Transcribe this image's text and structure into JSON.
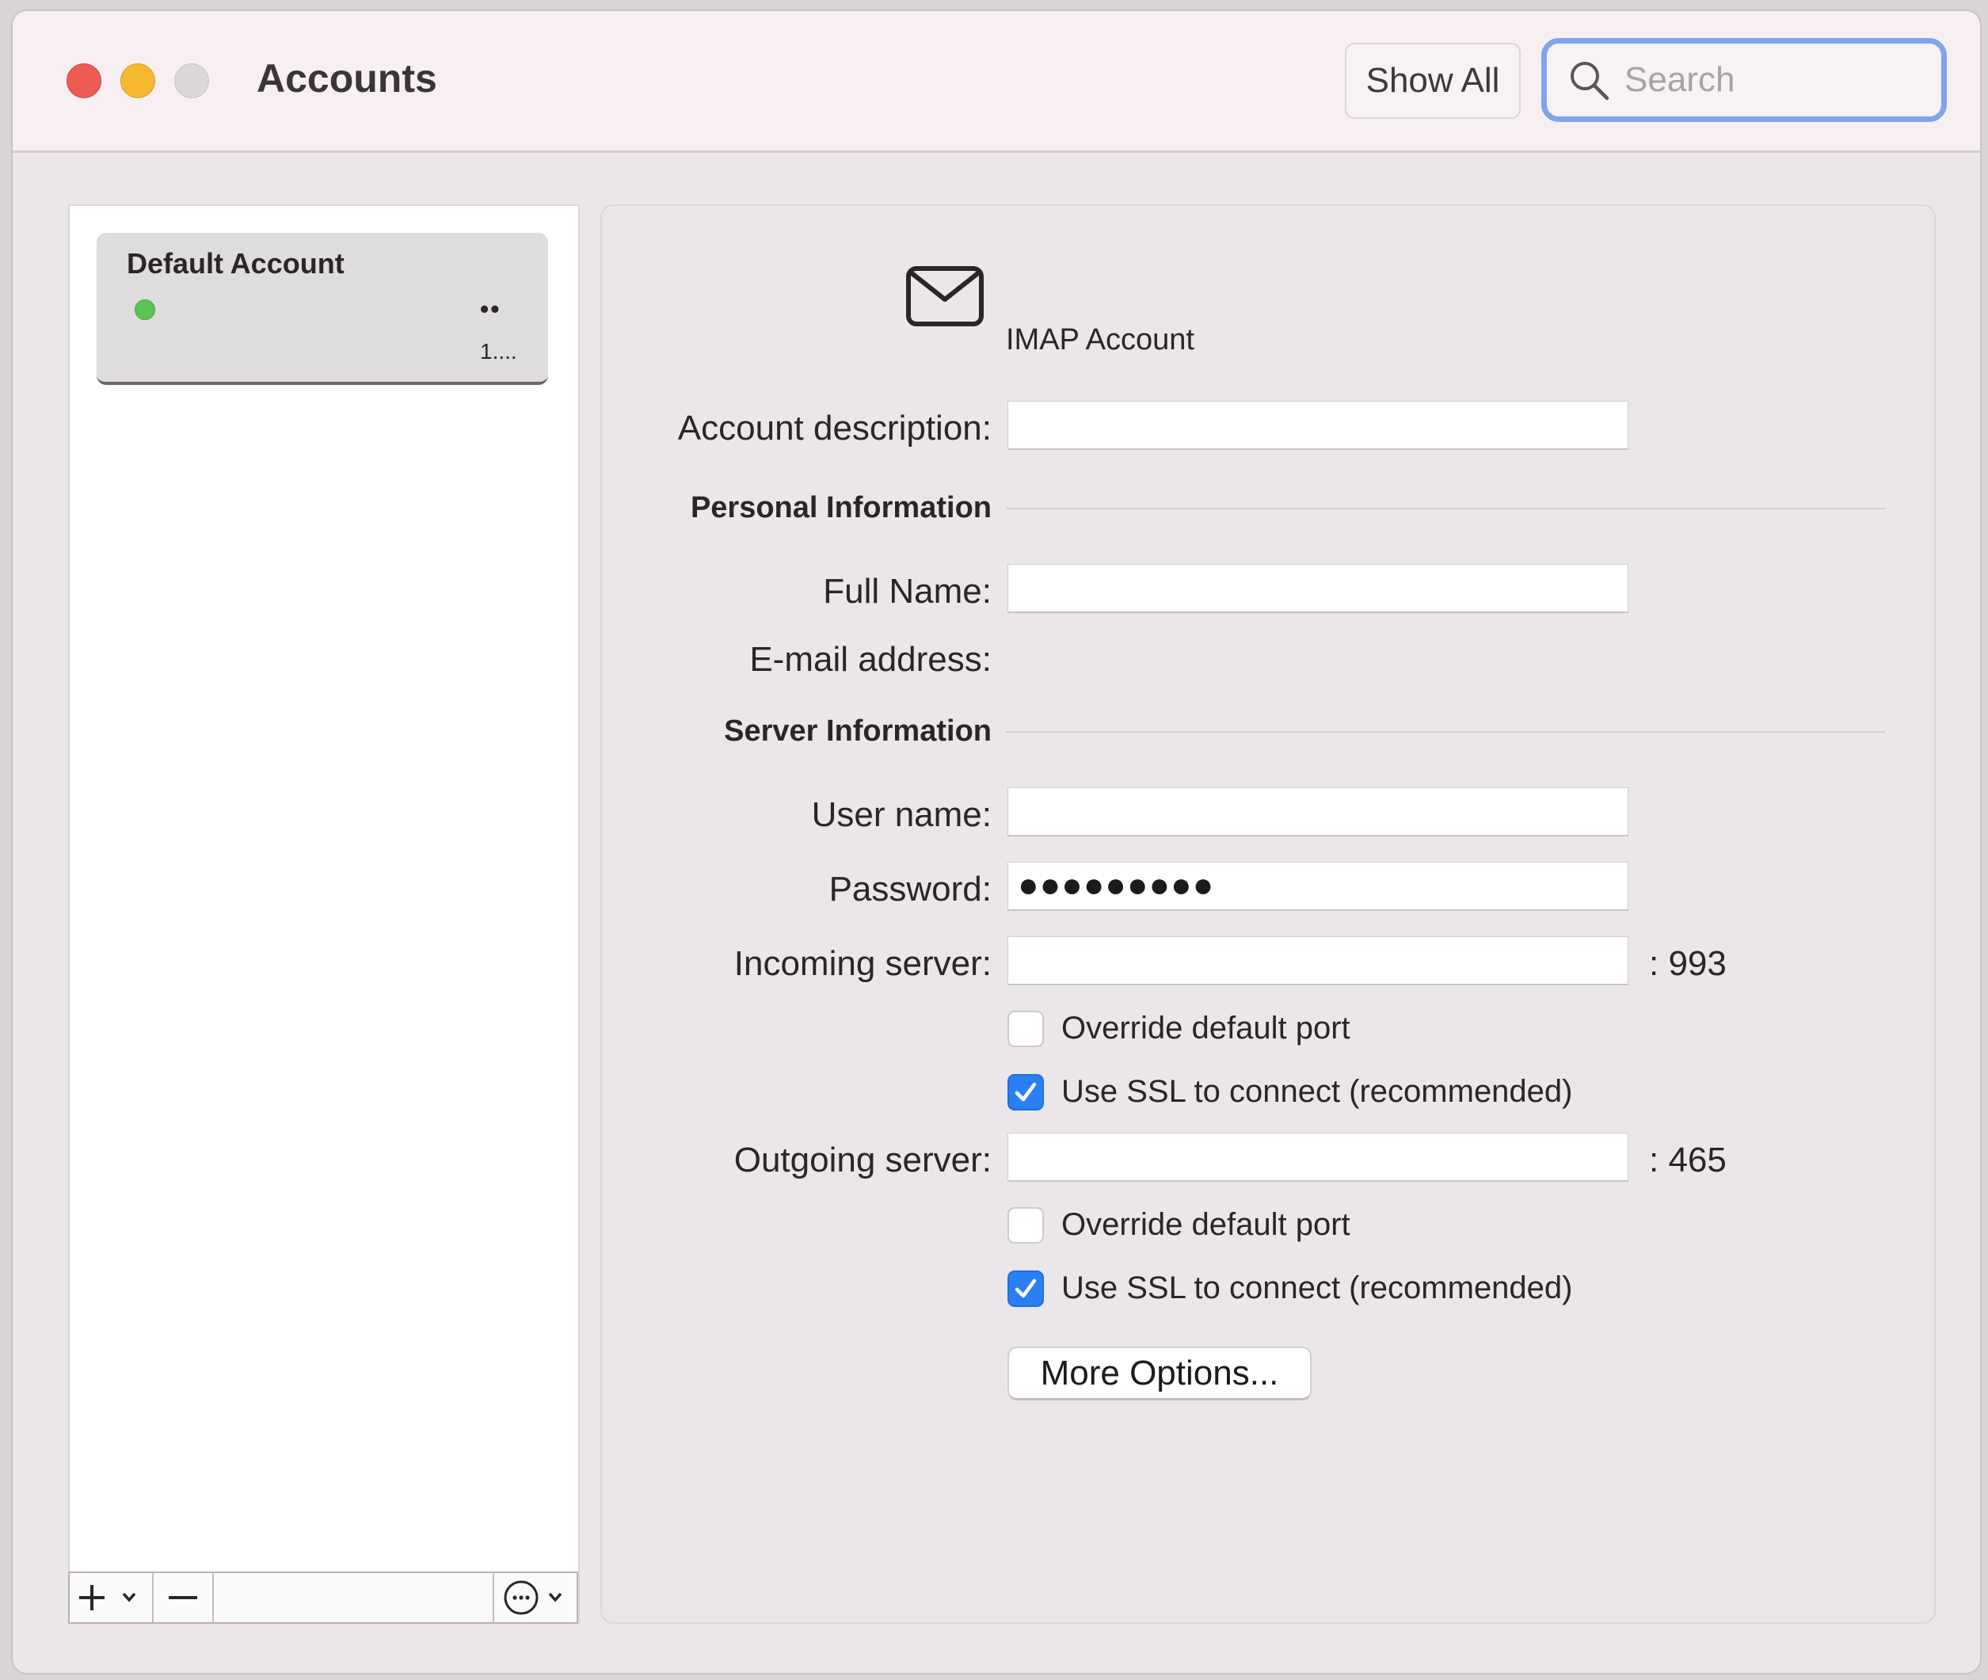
{
  "window": {
    "title": "Accounts",
    "show_all_label": "Show All",
    "search_placeholder": "Search"
  },
  "sidebar": {
    "accounts": [
      {
        "name": "Default Account",
        "status": "online",
        "detail_dots": "••",
        "detail_sub": "1...."
      }
    ],
    "toolbar": {
      "add_icon": "plus-icon",
      "remove_icon": "minus-icon",
      "action_icon": "ellipsis-circle-icon"
    }
  },
  "account": {
    "type": "IMAP Account",
    "icon": "envelope-icon",
    "description_label": "Account description:",
    "description_value": "",
    "personal_header": "Personal Information",
    "full_name_label": "Full Name:",
    "full_name_value": "",
    "email_label": "E-mail address:",
    "server_header": "Server Information",
    "username_label": "User name:",
    "username_value": "",
    "password_label": "Password:",
    "password_value": "●●●●●●●●●",
    "incoming_label": "Incoming server:",
    "incoming_value": "",
    "incoming_port": ": 993",
    "incoming_override_label": "Override default port",
    "incoming_override_checked": false,
    "incoming_ssl_label": "Use SSL to connect (recommended)",
    "incoming_ssl_checked": true,
    "outgoing_label": "Outgoing server:",
    "outgoing_value": "",
    "outgoing_port": ": 465",
    "outgoing_override_label": "Override default port",
    "outgoing_override_checked": false,
    "outgoing_ssl_label": "Use SSL to connect (recommended)",
    "outgoing_ssl_checked": true,
    "more_options_label": "More Options..."
  },
  "colors": {
    "accent": "#2a7ff5",
    "search_focus": "#7ea6ee",
    "close": "#ee5b55",
    "minimize": "#f6b830",
    "status_online": "#5bc454"
  }
}
